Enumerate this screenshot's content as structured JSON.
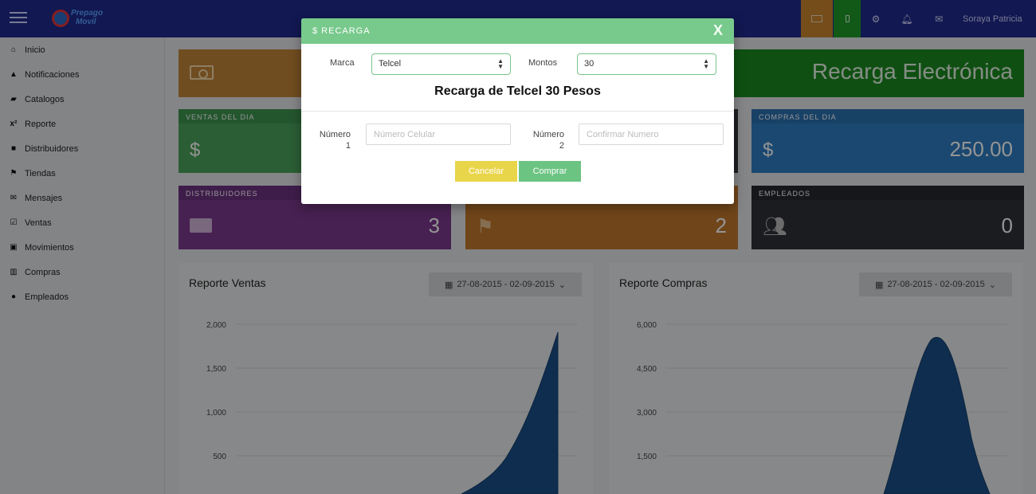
{
  "topbar": {
    "logo_line1": "Prepago",
    "logo_line2": "Movil",
    "user_name": "Soraya Patricia",
    "icons": [
      "money-icon",
      "mobile-icon",
      "gear-icon",
      "bell-icon",
      "envelope-icon"
    ],
    "colors": {
      "navbar": "#1f2a8c",
      "orange": "#c88530",
      "green": "#1f9a2a"
    }
  },
  "sidebar": {
    "items": [
      {
        "label": "Inicio",
        "icon": "home-icon"
      },
      {
        "label": "Notificaciones",
        "icon": "bell-icon"
      },
      {
        "label": "Catalogos",
        "icon": "book-icon"
      },
      {
        "label": "Reporte",
        "icon": "superscript-icon"
      },
      {
        "label": "Distribuidores",
        "icon": "briefcase-icon"
      },
      {
        "label": "Tiendas",
        "icon": "flag-icon"
      },
      {
        "label": "Mensajes",
        "icon": "envelope-icon"
      },
      {
        "label": "Ventas",
        "icon": "check-square-icon"
      },
      {
        "label": "Movimientos",
        "icon": "suitcase-icon"
      },
      {
        "label": "Compras",
        "icon": "barcode-icon"
      },
      {
        "label": "Empleados",
        "icon": "user-icon"
      }
    ]
  },
  "banner": {
    "title": "Recarga Electrónica"
  },
  "tiles": {
    "ventas": {
      "label": "VENTAS DEL DIA",
      "icon": "$"
    },
    "compras": {
      "label": "COMPRAS DEL DIA",
      "icon": "$",
      "value": "250.00"
    },
    "distribuidores": {
      "label": "DISTRIBUIDORES",
      "value": "3"
    },
    "tiendas": {
      "value": "2"
    },
    "empleados": {
      "label": "EMPLEADOS",
      "value": "0"
    }
  },
  "reports": {
    "ventas": {
      "title": "Reporte Ventas",
      "date_range": "27-08-2015 - 02-09-2015",
      "y_ticks": [
        "2,000",
        "1,500",
        "1,000",
        "500"
      ]
    },
    "compras": {
      "title": "Reporte Compras",
      "date_range": "27-08-2015 - 02-09-2015",
      "y_ticks": [
        "6,000",
        "4,500",
        "3,000",
        "1,500"
      ]
    }
  },
  "modal": {
    "title": "$ RECARGA",
    "close_label": "X",
    "brand_label": "Marca",
    "brand_value": "Telcel",
    "amount_label": "Montos",
    "amount_value": "30",
    "heading": "Recarga de Telcel 30 Pesos",
    "number1_label_a": "Número",
    "number1_label_b": "1",
    "number1_placeholder": "Número Celular",
    "number2_label_a": "Número",
    "number2_label_b": "2",
    "number2_placeholder": "Confirmar Numero",
    "cancel_label": "Cancelar",
    "buy_label": "Comprar",
    "colors": {
      "header": "#78c98c",
      "cancel": "#e9d54a",
      "buy": "#6cc482"
    }
  }
}
